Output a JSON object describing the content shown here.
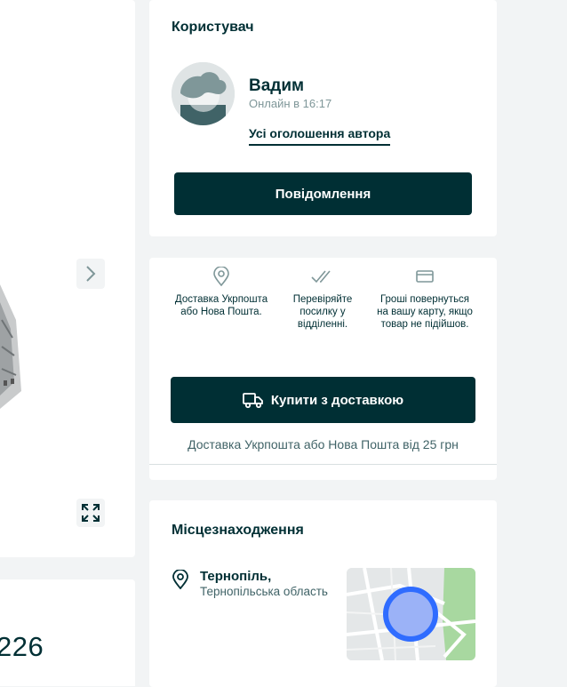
{
  "gallery": {
    "next_icon": "chevron-right-icon",
    "fullscreen_icon": "fullscreen-icon"
  },
  "ad_info": {
    "id_fragment": "226"
  },
  "user": {
    "section_title": "Користувач",
    "name": "Вадим",
    "online": "Онлайн в 16:17",
    "all_ads_link": "Усі оголошення автора",
    "message_button": "Повідомлення"
  },
  "delivery": {
    "features": [
      {
        "icon": "location-pin-icon",
        "text": "Доставка Укрпошта або Нова Пошта."
      },
      {
        "icon": "double-check-icon",
        "text": "Перевіряйте посилку у відділенні."
      },
      {
        "icon": "credit-card-icon",
        "text": "Гроші повернуться на вашу карту, якщо товар не підійшов."
      }
    ],
    "buy_button": "Купити з доставкою",
    "buy_icon": "truck-icon",
    "note": "Доставка Укрпошта або Нова Пошта від 25 грн"
  },
  "location": {
    "section_title": "Місцезнаходження",
    "city": "Тернопіль,",
    "region": "Тернопільська область"
  },
  "colors": {
    "primary": "#002f34",
    "background": "#f2f4f5",
    "map_marker": "#3a77ff"
  }
}
